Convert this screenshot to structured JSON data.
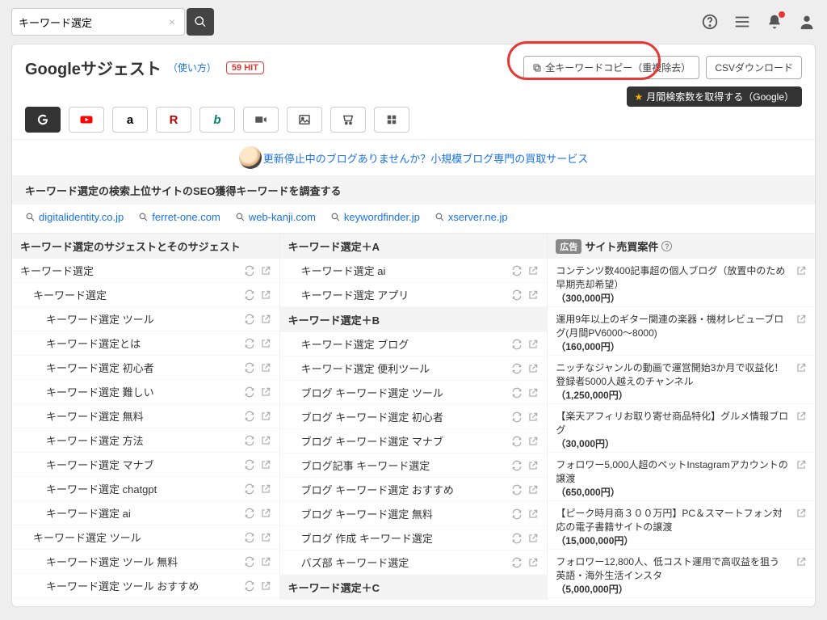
{
  "search": {
    "value": "キーワード選定",
    "clear": "×"
  },
  "header": {
    "title": "Googleサジェスト",
    "howto": "（使い方）",
    "hit": "59 HIT",
    "copy_btn": "全キーワードコピー（重複除去）",
    "csv_btn": "CSVダウンロード",
    "searchvol": "月間検索数を取得する（Google）"
  },
  "promo": {
    "text": "更新停止中のブログありませんか？小規模ブログ専門の買取サービス"
  },
  "seo": {
    "heading": "キーワード選定の検索上位サイトのSEO獲得キーワードを調査する",
    "sites": [
      "digitalidentity.co.jp",
      "ferret-one.com",
      "web-kanji.com",
      "keywordfinder.jp",
      "xserver.ne.jp"
    ]
  },
  "col1": {
    "heading": "キーワード選定のサジェストとそのサジェスト",
    "rows": [
      {
        "t": "キーワード選定",
        "i": 0
      },
      {
        "t": "キーワード選定",
        "i": 1
      },
      {
        "t": "キーワード選定 ツール",
        "i": 2
      },
      {
        "t": "キーワード選定とは",
        "i": 2
      },
      {
        "t": "キーワード選定 初心者",
        "i": 2
      },
      {
        "t": "キーワード選定 難しい",
        "i": 2
      },
      {
        "t": "キーワード選定 無料",
        "i": 2
      },
      {
        "t": "キーワード選定 方法",
        "i": 2
      },
      {
        "t": "キーワード選定 マナブ",
        "i": 2
      },
      {
        "t": "キーワード選定 chatgpt",
        "i": 2
      },
      {
        "t": "キーワード選定 ai",
        "i": 2
      },
      {
        "t": "キーワード選定 ツール",
        "i": 1
      },
      {
        "t": "キーワード選定 ツール 無料",
        "i": 2
      },
      {
        "t": "キーワード選定 ツール おすすめ",
        "i": 2
      }
    ]
  },
  "col2": {
    "groups": [
      {
        "h": "キーワード選定＋A",
        "rows": [
          {
            "t": "キーワード選定 ai"
          },
          {
            "t": "キーワード選定 アプリ"
          }
        ]
      },
      {
        "h": "キーワード選定＋B",
        "rows": [
          {
            "t": "キーワード選定 ブログ"
          },
          {
            "t": "キーワード選定 便利ツール"
          },
          {
            "t": "ブログ キーワード選定 ツール"
          },
          {
            "t": "ブログ キーワード選定 初心者"
          },
          {
            "t": "ブログ キーワード選定 マナブ"
          },
          {
            "t": "ブログ記事 キーワード選定"
          },
          {
            "t": "ブログ キーワード選定 おすすめ"
          },
          {
            "t": "ブログ キーワード選定 無料"
          },
          {
            "t": "ブログ 作成 キーワード選定"
          },
          {
            "t": "バズ部 キーワード選定"
          }
        ]
      },
      {
        "h": "キーワード選定＋C",
        "rows": []
      }
    ]
  },
  "col3": {
    "ad_label": "広告",
    "heading": "サイト売買案件",
    "items": [
      {
        "t": "コンテンツ数400記事超の個人ブログ（放置中のため早期売却希望）",
        "p": "（300,000円）"
      },
      {
        "t": "運用9年以上のギター関連の楽器・機材レビューブログ(月間PV6000〜8000)",
        "p": "（160,000円）"
      },
      {
        "t": "ニッチなジャンルの動画で運営開始3か月で収益化！登録者5000人越えのチャンネル",
        "p": "（1,250,000円）"
      },
      {
        "t": "【楽天アフィリお取り寄せ商品特化】グルメ情報ブログ",
        "p": "（30,000円）"
      },
      {
        "t": "フォロワー5,000人超のペットInstagramアカウントの譲渡",
        "p": "（650,000円）"
      },
      {
        "t": "【ピーク時月商３００万円】PC＆スマートフォン対応の電子書籍サイトの譲渡",
        "p": "（15,000,000円）"
      },
      {
        "t": "フォロワー12,800人、低コスト運用で高収益を狙う英語・海外生活インスタ",
        "p": "（5,000,000円）"
      }
    ]
  }
}
